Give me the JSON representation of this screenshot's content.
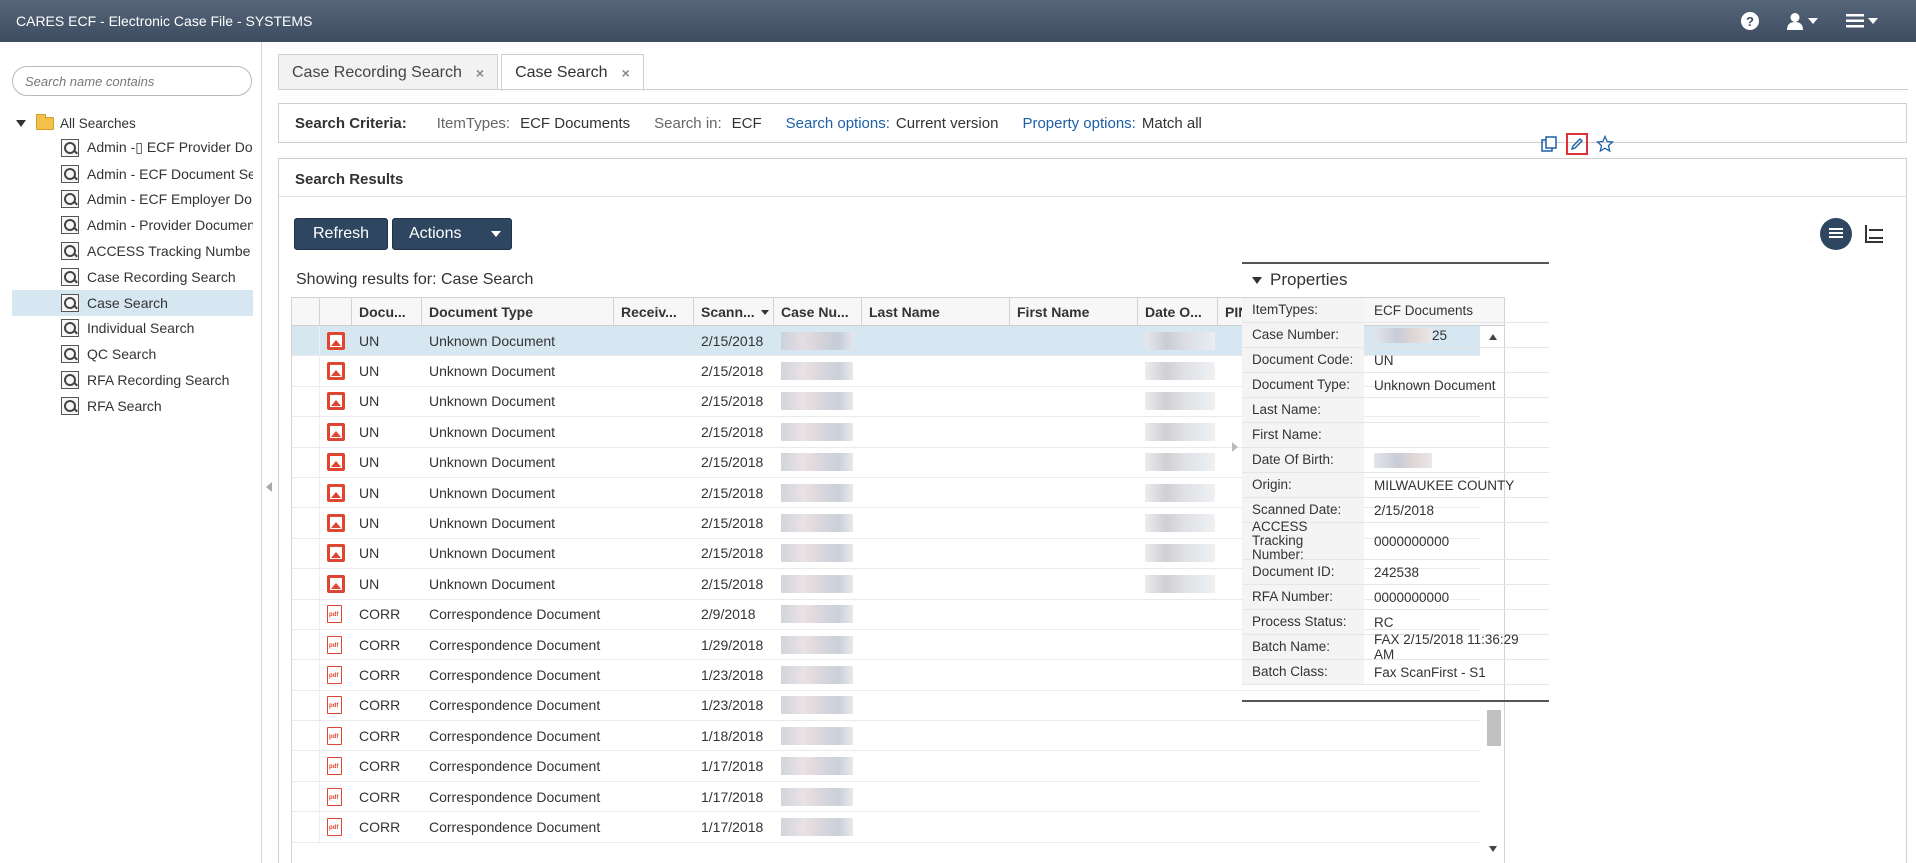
{
  "app": {
    "title": "CARES ECF - Electronic Case File - SYSTEMS"
  },
  "sidebar": {
    "search_placeholder": "Search name contains",
    "root_label": "All Searches",
    "items": [
      {
        "label": "Admin -▯ ECF Provider Do"
      },
      {
        "label": "Admin - ECF Document Se"
      },
      {
        "label": "Admin - ECF Employer Do"
      },
      {
        "label": "Admin - Provider Documen"
      },
      {
        "label": "ACCESS Tracking Numbe"
      },
      {
        "label": "Case Recording Search"
      },
      {
        "label": "Case Search",
        "selected": true
      },
      {
        "label": "Individual Search"
      },
      {
        "label": "QC Search"
      },
      {
        "label": "RFA Recording Search"
      },
      {
        "label": "RFA Search"
      }
    ]
  },
  "tabs": [
    {
      "label": "Case Recording Search",
      "active": false
    },
    {
      "label": "Case Search",
      "active": true
    }
  ],
  "criteria": {
    "lead": "Search Criteria:",
    "itemtypes_key": "ItemTypes:",
    "itemtypes_val": "ECF Documents",
    "searchin_key": "Search in:",
    "searchin_val": "ECF",
    "searchopt_key": "Search options:",
    "searchopt_val": "Current version",
    "propopt_key": "Property options:",
    "propopt_val": "Match all"
  },
  "results": {
    "title": "Search Results",
    "refresh_label": "Refresh",
    "actions_label": "Actions",
    "showing": "Showing results for: Case Search"
  },
  "grid": {
    "headers": [
      "Docu...",
      "Document Type",
      "Receiv...",
      "Scann...",
      "Case Nu...",
      "Last Name",
      "First Name",
      "Date O...",
      "PIN"
    ],
    "rows": [
      {
        "icon": "image",
        "code": "UN",
        "type": "Unknown Document",
        "scanned": "2/15/2018",
        "selected": true
      },
      {
        "icon": "image",
        "code": "UN",
        "type": "Unknown Document",
        "scanned": "2/15/2018"
      },
      {
        "icon": "image",
        "code": "UN",
        "type": "Unknown Document",
        "scanned": "2/15/2018"
      },
      {
        "icon": "image",
        "code": "UN",
        "type": "Unknown Document",
        "scanned": "2/15/2018"
      },
      {
        "icon": "image",
        "code": "UN",
        "type": "Unknown Document",
        "scanned": "2/15/2018"
      },
      {
        "icon": "image",
        "code": "UN",
        "type": "Unknown Document",
        "scanned": "2/15/2018"
      },
      {
        "icon": "image",
        "code": "UN",
        "type": "Unknown Document",
        "scanned": "2/15/2018"
      },
      {
        "icon": "image",
        "code": "UN",
        "type": "Unknown Document",
        "scanned": "2/15/2018"
      },
      {
        "icon": "image",
        "code": "UN",
        "type": "Unknown Document",
        "scanned": "2/15/2018"
      },
      {
        "icon": "pdf",
        "code": "CORR",
        "type": "Correspondence Document",
        "scanned": "2/9/2018"
      },
      {
        "icon": "pdf",
        "code": "CORR",
        "type": "Correspondence Document",
        "scanned": "1/29/2018"
      },
      {
        "icon": "pdf",
        "code": "CORR",
        "type": "Correspondence Document",
        "scanned": "1/23/2018"
      },
      {
        "icon": "pdf",
        "code": "CORR",
        "type": "Correspondence Document",
        "scanned": "1/23/2018"
      },
      {
        "icon": "pdf",
        "code": "CORR",
        "type": "Correspondence Document",
        "scanned": "1/18/2018"
      },
      {
        "icon": "pdf",
        "code": "CORR",
        "type": "Correspondence Document",
        "scanned": "1/17/2018"
      },
      {
        "icon": "pdf",
        "code": "CORR",
        "type": "Correspondence Document",
        "scanned": "1/17/2018"
      },
      {
        "icon": "pdf",
        "code": "CORR",
        "type": "Correspondence Document",
        "scanned": "1/17/2018"
      }
    ]
  },
  "properties": {
    "title": "Properties",
    "items": [
      {
        "key": "ItemTypes:",
        "value": "ECF Documents"
      },
      {
        "key": "Case Number:",
        "value": "25",
        "partial_blur": true
      },
      {
        "key": "Document Code:",
        "value": "UN"
      },
      {
        "key": "Document Type:",
        "value": "Unknown Document"
      },
      {
        "key": "Last Name:",
        "value": ""
      },
      {
        "key": "First Name:",
        "value": ""
      },
      {
        "key": "Date Of Birth:",
        "value": "",
        "blurred": true
      },
      {
        "key": "Origin:",
        "value": "MILWAUKEE COUNTY"
      },
      {
        "key": "Scanned Date:",
        "value": "2/15/2018"
      },
      {
        "key": "ACCESS Tracking Number:",
        "value": "0000000000"
      },
      {
        "key": "Document ID:",
        "value": "242538"
      },
      {
        "key": "RFA Number:",
        "value": "0000000000"
      },
      {
        "key": "Process Status:",
        "value": "RC"
      },
      {
        "key": "Batch Name:",
        "value": "FAX 2/15/2018 11:36:29 AM"
      },
      {
        "key": "Batch Class:",
        "value": "Fax ScanFirst - S1"
      }
    ]
  },
  "icons": {
    "help": "help-icon",
    "user": "user-icon",
    "menu": "hamburger-menu-icon",
    "copy": "copy-icon",
    "edit": "edit-pencil-icon",
    "favorite": "star-icon"
  }
}
